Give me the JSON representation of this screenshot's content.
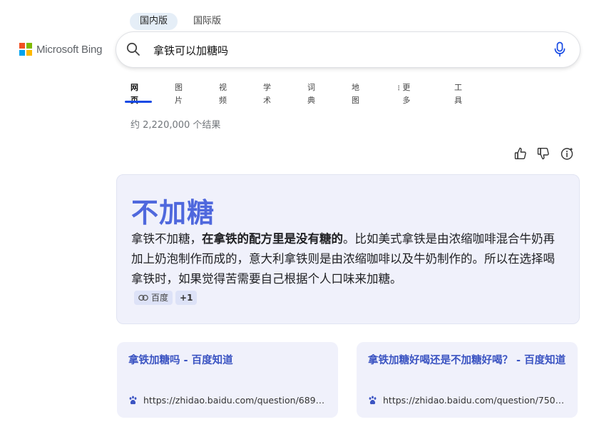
{
  "region_tabs": {
    "domestic": "国内版",
    "international": "国际版"
  },
  "brand": {
    "name": "Microsoft Bing",
    "colors": [
      "#f25022",
      "#7fba00",
      "#00a4ef",
      "#ffb900"
    ]
  },
  "search": {
    "query": "拿铁可以加糖吗",
    "icon": "search-icon",
    "mic_icon": "mic-icon"
  },
  "nav": {
    "web": "网页",
    "images": "图片",
    "videos": "视频",
    "academic": "学术",
    "dictionary": "词典",
    "maps": "地图",
    "more": "更多",
    "tools": "工具",
    "accent_color": "#174ae4"
  },
  "result_count": "约 2,220,000 个结果",
  "answer": {
    "headline": "不加糖",
    "text_before": "拿铁不加糖，",
    "text_bold": "在拿铁的配方里是没有糖的",
    "text_after": "。比如美式拿铁是由浓缩咖啡混合牛奶再加上奶泡制作而成的，意大利拿铁则是由浓缩咖啡以及牛奶制作的。所以在选择喝拿铁时，如果觉得苦需要自己根据个人口味来加糖。",
    "source": "百度",
    "more_sources": "+1",
    "headline_color": "#4f68dd"
  },
  "results": [
    {
      "title": "拿铁加糖吗 - 百度知道",
      "url": "https://zhidao.baidu.com/question/689911..."
    },
    {
      "title": "拿铁加糖好喝还是不加糖好喝？ - 百度知道",
      "url": "https://zhidao.baidu.com/question/750965..."
    }
  ]
}
